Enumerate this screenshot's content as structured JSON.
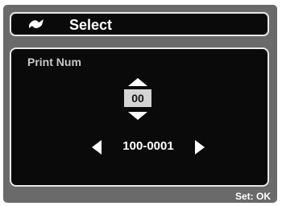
{
  "header": {
    "icon": "print-icon",
    "title": "Select"
  },
  "panel": {
    "label": "Print Num",
    "quantity": "00",
    "file_number": "100-0001"
  },
  "footer": {
    "hint": "Set: OK"
  },
  "colors": {
    "screen_bg": "#6a6a6a",
    "panel_bg": "#0a0a0a",
    "border": "#e8e8e8",
    "value_box": "#d4d4d4"
  }
}
